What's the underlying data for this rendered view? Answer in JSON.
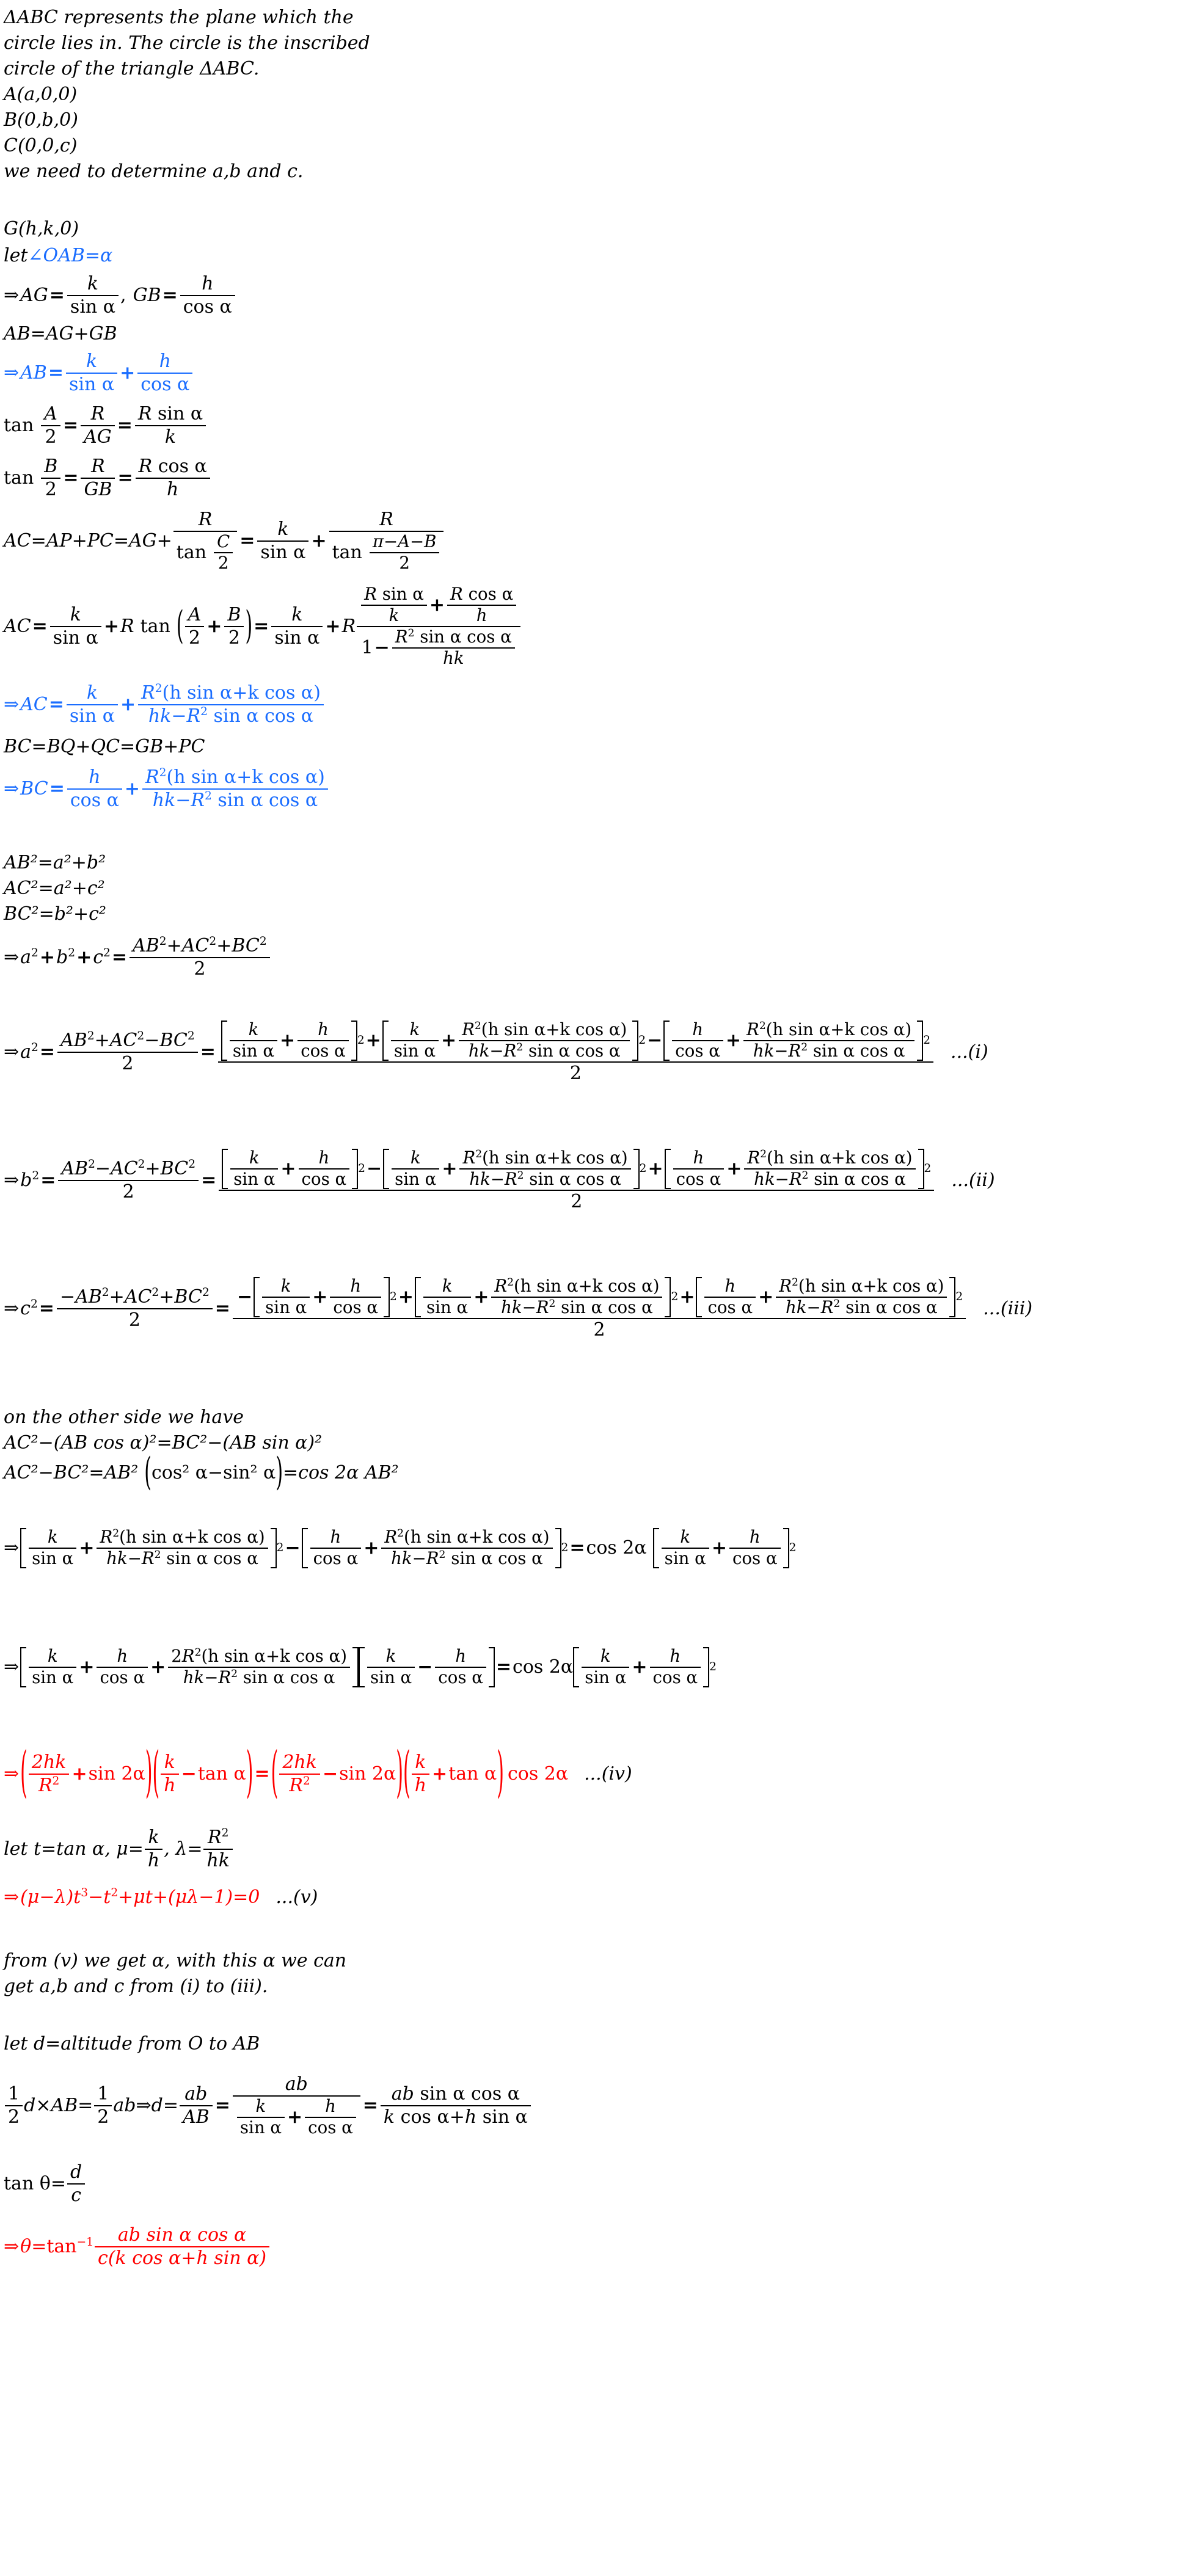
{
  "document": {
    "kind": "handwritten-style math solution",
    "colors": {
      "black": "#000000",
      "blue": "#1a6dff",
      "red": "#ff0000"
    }
  },
  "intro": {
    "l1": "ΔABC represents the plane which the",
    "l2": "circle lies in. The circle is the inscribed",
    "l3": "circle of the triangle ΔABC.",
    "pointA": "A(a,0,0)",
    "pointB": "B(0,b,0)",
    "pointC": "C(0,0,c)",
    "goal": "we need to determine a,b and c."
  },
  "setup": {
    "pointG": "G(h,k,0)",
    "let_angle_prefix": "let ",
    "let_angle": "∠OAB=α",
    "ag_label": "AG",
    "gb_label": "GB",
    "ab_sum": "AB=AG+GB"
  },
  "symbols": {
    "k": "k",
    "h": "h",
    "R": "R",
    "A": "A",
    "B": "B",
    "C": "C",
    "sin_a": "sin α",
    "cos_a": "cos α",
    "alpha": "α",
    "two": "2",
    "one": "1",
    "pi": "π",
    "theta": "θ",
    "hk": "hk",
    "ab": "ab",
    "d": "d",
    "c": "c",
    "t": "t",
    "mu": "μ",
    "lambda": "λ",
    "tan": "tan",
    "sin": "sin",
    "cos": "cos",
    "R2": "R",
    "sq": "2",
    "cube": "3",
    "hsin_plus_kcos": "h sin α+k cos α",
    "hk_minus": "hk−R",
    "sin_cos": "sin α cos α",
    "Rsin": "R sin α",
    "Rcos": "R cos α",
    "pi_A_B": "π−A−B"
  },
  "labels": {
    "AB": "AB",
    "AC": "AC",
    "BC": "BC",
    "AG": "AG",
    "GB": "GB",
    "AP": "AP",
    "PC": "PC",
    "BQ": "BQ",
    "QC": "QC",
    "eqAC": "AC=AP+PC=AG+",
    "eqBC": "BC=BQ+QC=GB+PC",
    "a": "a",
    "b": "b",
    "cc": "c"
  },
  "squares": {
    "AB2": "AB²=a²+b²",
    "AC2": "AC²=a²+c²",
    "BC2": "BC²=b²+c²"
  },
  "tags": {
    "i": "...(i)",
    "ii": "...(ii)",
    "iii": "...(iii)",
    "iv": "...(iv)",
    "v": "...(v)"
  },
  "other_side": {
    "heading": "on the other side we have",
    "line1": "AC²−(AB cos α)²=BC²−(AB sin α)²",
    "line2_a": "AC²−BC²=AB²",
    "line2_b": "cos² α−sin² α",
    "line2_c": "=cos 2α AB²",
    "cos2a": "cos 2α",
    "twohk": "2hk",
    "sin2a": "sin 2α",
    "tan_a": "tan α",
    "two_R2": "2R"
  },
  "substitution": {
    "let_line": "let t=tan α, μ=",
    "let_mid": ", λ=",
    "cubic": "(μ−λ)t³−t²+μt+(μλ−1)=0"
  },
  "closing": {
    "from_v_1": "from (v) we get α, with this α we can",
    "from_v_2": "get a,b and c from (i) to (iii).",
    "altitude": "let d=altitude from O to AB",
    "area_lead": "d×AB=",
    "area_mid": "ab⇒d=",
    "tan_theta": "tan θ=",
    "final_num": "ab sin α cos α",
    "final_den": "c(k cos α+h sin α)",
    "final_lead": "⇒θ=tan",
    "final_exp": "−1",
    "d_num": "ab",
    "result_num": "ab sin α cos α",
    "result_den": "k cos α+h sin α"
  }
}
